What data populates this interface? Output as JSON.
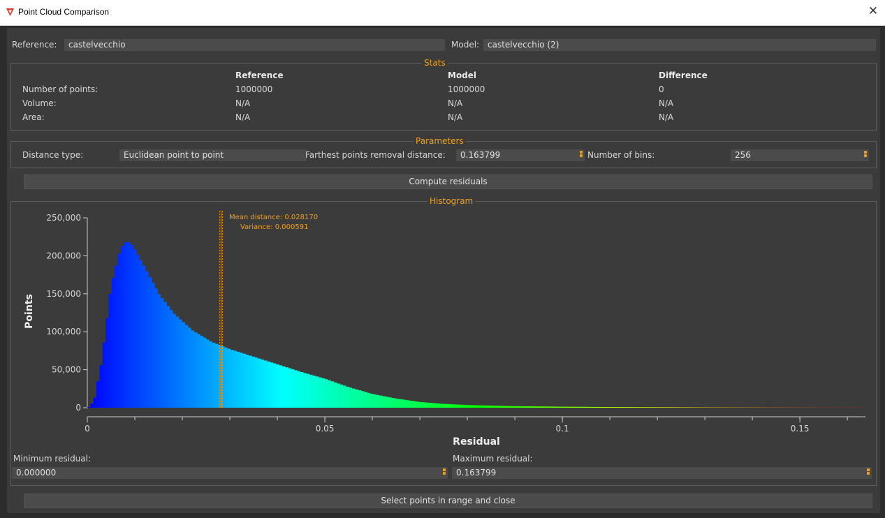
{
  "window": {
    "title": "Point Cloud Comparison",
    "close_glyph": "✕"
  },
  "reference": {
    "label": "Reference:",
    "value": "castelvecchio"
  },
  "model": {
    "label": "Model:",
    "value": "castelvecchio (2)"
  },
  "stats": {
    "title": "Stats",
    "columns": [
      "Reference",
      "Model",
      "Difference"
    ],
    "rows": [
      {
        "label": "Number of points:",
        "values": [
          "1000000",
          "1000000",
          "0"
        ]
      },
      {
        "label": "Volume:",
        "values": [
          "N/A",
          "N/A",
          "N/A"
        ]
      },
      {
        "label": "Area:",
        "values": [
          "N/A",
          "N/A",
          "N/A"
        ]
      }
    ]
  },
  "parameters": {
    "title": "Parameters",
    "distance_type_label": "Distance type:",
    "distance_type_value": "Euclidean point to point",
    "removal_label": "Farthest points removal distance:",
    "removal_value": "0.163799",
    "bins_label": "Number of bins:",
    "bins_value": "256"
  },
  "compute_button": "Compute residuals",
  "histogram": {
    "title": "Histogram"
  },
  "chart_data": {
    "type": "bar",
    "xlabel": "Residual",
    "ylabel": "Points",
    "xlim": [
      0,
      0.1638
    ],
    "ylim": [
      0,
      250000
    ],
    "xticks": [
      0,
      0.05,
      0.1,
      0.15
    ],
    "xtick_labels": [
      "0",
      "0.05",
      "0.1",
      "0.15"
    ],
    "yticks": [
      0,
      50000,
      100000,
      150000,
      200000,
      250000
    ],
    "ytick_labels": [
      "0",
      "50,000",
      "100,000",
      "150,000",
      "200,000",
      "250,000"
    ],
    "bins": 256,
    "bin_edges": [
      0,
      0.1638
    ],
    "colormap": [
      "#0000ff",
      "#00ffff",
      "#00ff00",
      "#ffff00",
      "#ff0000"
    ],
    "histogram_profile": {
      "x": [
        0,
        0.0005,
        0.0015,
        0.003,
        0.005,
        0.007,
        0.0083,
        0.0095,
        0.012,
        0.015,
        0.018,
        0.022,
        0.026,
        0.03,
        0.035,
        0.04,
        0.045,
        0.05,
        0.055,
        0.06,
        0.065,
        0.07,
        0.075,
        0.08,
        0.09,
        0.1,
        0.11,
        0.12,
        0.13,
        0.14,
        0.15,
        0.1638
      ],
      "y": [
        0,
        1500,
        10000,
        60000,
        160000,
        210000,
        220000,
        213000,
        185000,
        150000,
        125000,
        102000,
        87000,
        77000,
        67000,
        57000,
        47000,
        38000,
        27000,
        18000,
        12000,
        7500,
        5000,
        3500,
        2000,
        1300,
        900,
        600,
        400,
        300,
        200,
        100
      ]
    },
    "mean_distance": 0.02817,
    "variance": 0.000591,
    "annotations": [
      "Mean distance: 0.028170",
      "Variance: 0.000591"
    ],
    "annotation_color": "#f2a01e"
  },
  "min_residual": {
    "label": "Minimum residual:",
    "value": "0.000000"
  },
  "max_residual": {
    "label": "Maximum residual:",
    "value": "0.163799"
  },
  "select_button": "Select points in range and close"
}
